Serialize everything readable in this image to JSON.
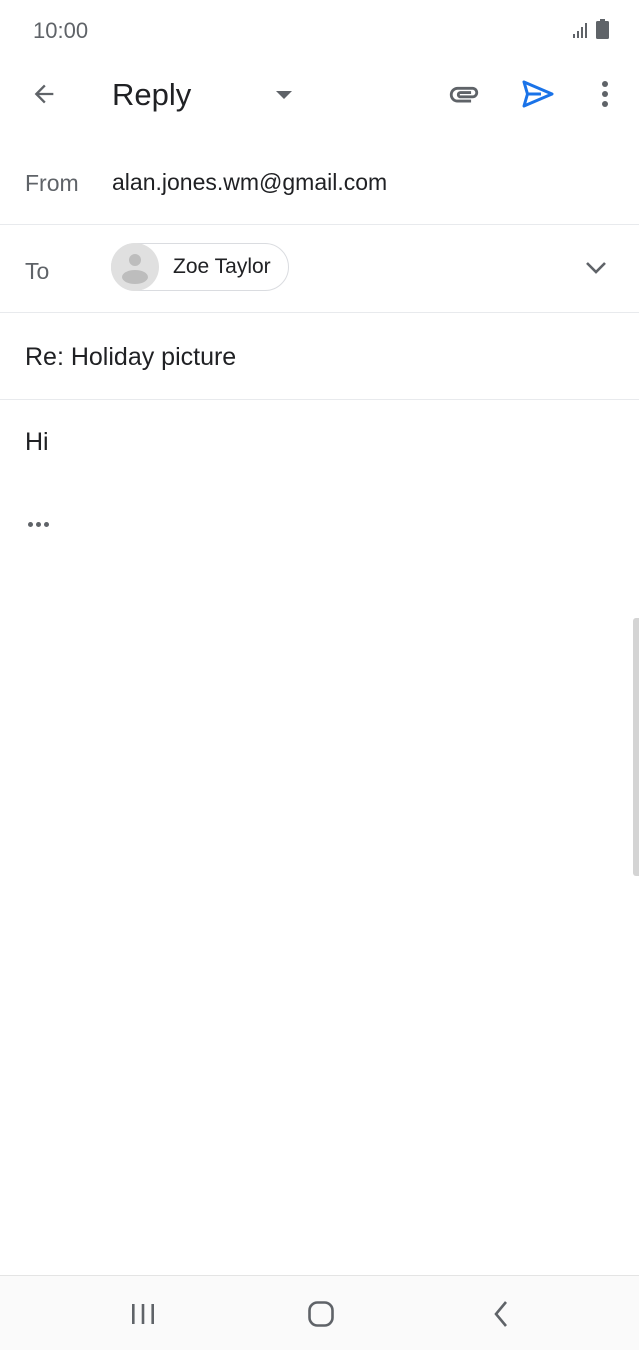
{
  "status_bar": {
    "time": "10:00",
    "signal_icon": "signal-icon",
    "battery_icon": "battery-icon"
  },
  "app_bar": {
    "back_icon": "arrow-back-icon",
    "mode_label": "Reply",
    "mode_dropdown_icon": "caret-down-icon",
    "attach_icon": "paperclip-icon",
    "send_icon": "send-icon",
    "more_icon": "more-vert-icon"
  },
  "compose": {
    "from_label": "From",
    "from_value": "alan.jones.wm@gmail.com",
    "to_label": "To",
    "recipients": [
      {
        "name": "Zoe Taylor",
        "avatar_icon": "person-icon"
      }
    ],
    "expand_icon": "chevron-down-icon",
    "subject": "Re: Holiday picture",
    "body": "Hi",
    "quoted_text_icon": "more-horiz-icon"
  },
  "nav_bar": {
    "recents_icon": "recents-icon",
    "home_icon": "home-icon",
    "back_icon": "nav-back-icon"
  },
  "colors": {
    "accent": "#1a73e8",
    "text_primary": "#202124",
    "text_secondary": "#5f6368",
    "divider": "#e8eaed"
  }
}
